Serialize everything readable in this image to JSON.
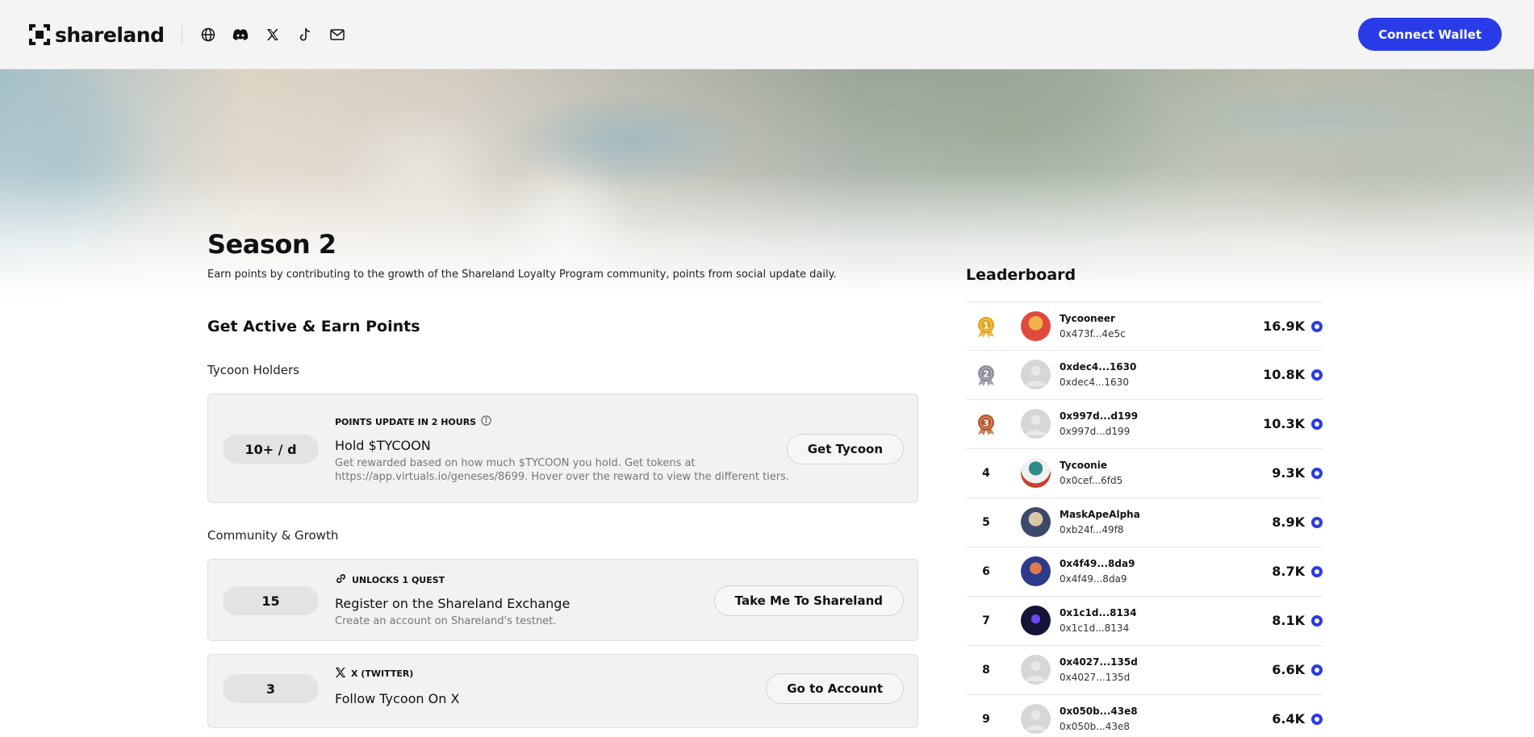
{
  "brand": {
    "name": "shareland"
  },
  "header": {
    "social_icons": [
      "globe-icon",
      "discord-icon",
      "x-icon",
      "tiktok-icon",
      "mail-icon"
    ],
    "connect_label": "Connect Wallet"
  },
  "colors": {
    "accent": "#2a3be8",
    "card_bg": "#f2f2f2",
    "gold": "#e2a41a",
    "silver": "#8a8a9a",
    "bronze": "#b8542a"
  },
  "season": {
    "title": "Season 2",
    "subtitle": "Earn points by contributing to the growth of the Shareland Loyalty Program community, points from social update daily."
  },
  "earn": {
    "heading": "Get Active & Earn Points",
    "groups": [
      {
        "title": "Tycoon Holders",
        "cards": [
          {
            "points": "10+ / d",
            "meta": "POINTS UPDATE IN 2 HOURS",
            "meta_icon": "info-icon",
            "title": "Hold $TYCOON",
            "desc": "Get rewarded based on how much $TYCOON you hold. Get tokens at https://app.virtuals.io/geneses/8699. Hover over the reward to view the different tiers.",
            "button": "Get Tycoon"
          }
        ]
      },
      {
        "title": "Community & Growth",
        "cards": [
          {
            "points": "15",
            "meta": "UNLOCKS 1 QUEST",
            "meta_icon": "link-icon",
            "title": "Register on the Shareland Exchange",
            "desc": "Create an account on Shareland's testnet.",
            "button": "Take Me To Shareland"
          },
          {
            "points": "3",
            "meta": "X (TWITTER)",
            "meta_icon": "x-icon",
            "title": "Follow Tycoon On X",
            "desc": "",
            "button": "Go to Account"
          }
        ]
      }
    ]
  },
  "leaderboard": {
    "title": "Leaderboard",
    "rows": [
      {
        "rank": "1",
        "medal": "gold",
        "name": "Tycooneer",
        "addr": "0x473f...4e5c",
        "score": "16.9K",
        "avatar": "avatar-character"
      },
      {
        "rank": "2",
        "medal": "silver",
        "name": "0xdec4...1630",
        "addr": "0xdec4...1630",
        "score": "10.8K",
        "avatar": "avatar-placeholder"
      },
      {
        "rank": "3",
        "medal": "bronze",
        "name": "0x997d...d199",
        "addr": "0x997d...d199",
        "score": "10.3K",
        "avatar": "avatar-placeholder"
      },
      {
        "rank": "4",
        "medal": "",
        "name": "Tycoonie",
        "addr": "0x0cef...6fd5",
        "score": "9.3K",
        "avatar": "avatar-character"
      },
      {
        "rank": "5",
        "medal": "",
        "name": "MaskApeAlpha",
        "addr": "0xb24f...49f8",
        "score": "8.9K",
        "avatar": "avatar-photo"
      },
      {
        "rank": "6",
        "medal": "",
        "name": "0x4f49...8da9",
        "addr": "0x4f49...8da9",
        "score": "8.7K",
        "avatar": "avatar-photo"
      },
      {
        "rank": "7",
        "medal": "",
        "name": "0x1c1d...8134",
        "addr": "0x1c1d...8134",
        "score": "8.1K",
        "avatar": "avatar-photo"
      },
      {
        "rank": "8",
        "medal": "",
        "name": "0x4027...135d",
        "addr": "0x4027...135d",
        "score": "6.6K",
        "avatar": "avatar-placeholder"
      },
      {
        "rank": "9",
        "medal": "",
        "name": "0x050b...43e8",
        "addr": "0x050b...43e8",
        "score": "6.4K",
        "avatar": "avatar-placeholder"
      }
    ]
  }
}
